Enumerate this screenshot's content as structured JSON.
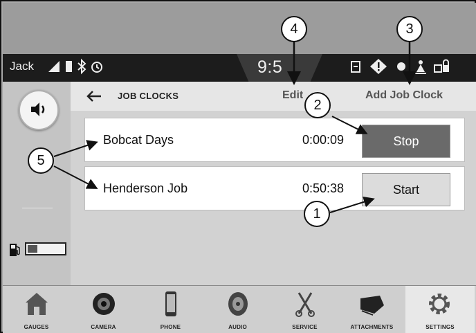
{
  "status_bar": {
    "user": "Jack",
    "time": "9:5",
    "icons": [
      "signal-icon",
      "battery-icon",
      "bluetooth-icon",
      "timer-icon",
      "fuel-filter-icon",
      "warning-icon",
      "seatbelt-icon",
      "operator-icon",
      "lock-icon"
    ]
  },
  "sidebar": {
    "volume_icon": "speaker-icon",
    "fuel_icon": "fuel-pump-icon",
    "fuel_level": 0.25
  },
  "header": {
    "title": "JOB CLOCKS",
    "edit_label": "Edit",
    "add_label": "Add Job Clock"
  },
  "jobs": [
    {
      "name": "Bobcat Days",
      "time": "0:00:09",
      "button": "Stop"
    },
    {
      "name": "Henderson Job",
      "time": "0:50:38",
      "button": "Start"
    }
  ],
  "callouts": [
    "1",
    "2",
    "3",
    "4",
    "5"
  ],
  "nav": [
    {
      "label": "GAUGES",
      "icon": "house-icon"
    },
    {
      "label": "CAMERA",
      "icon": "camera-icon"
    },
    {
      "label": "PHONE",
      "icon": "phone-icon"
    },
    {
      "label": "AUDIO",
      "icon": "speaker-icon"
    },
    {
      "label": "SERVICE",
      "icon": "wrench-icon"
    },
    {
      "label": "ATTACHMENTS",
      "icon": "bucket-icon"
    },
    {
      "label": "SETTINGS",
      "icon": "gear-icon"
    }
  ]
}
